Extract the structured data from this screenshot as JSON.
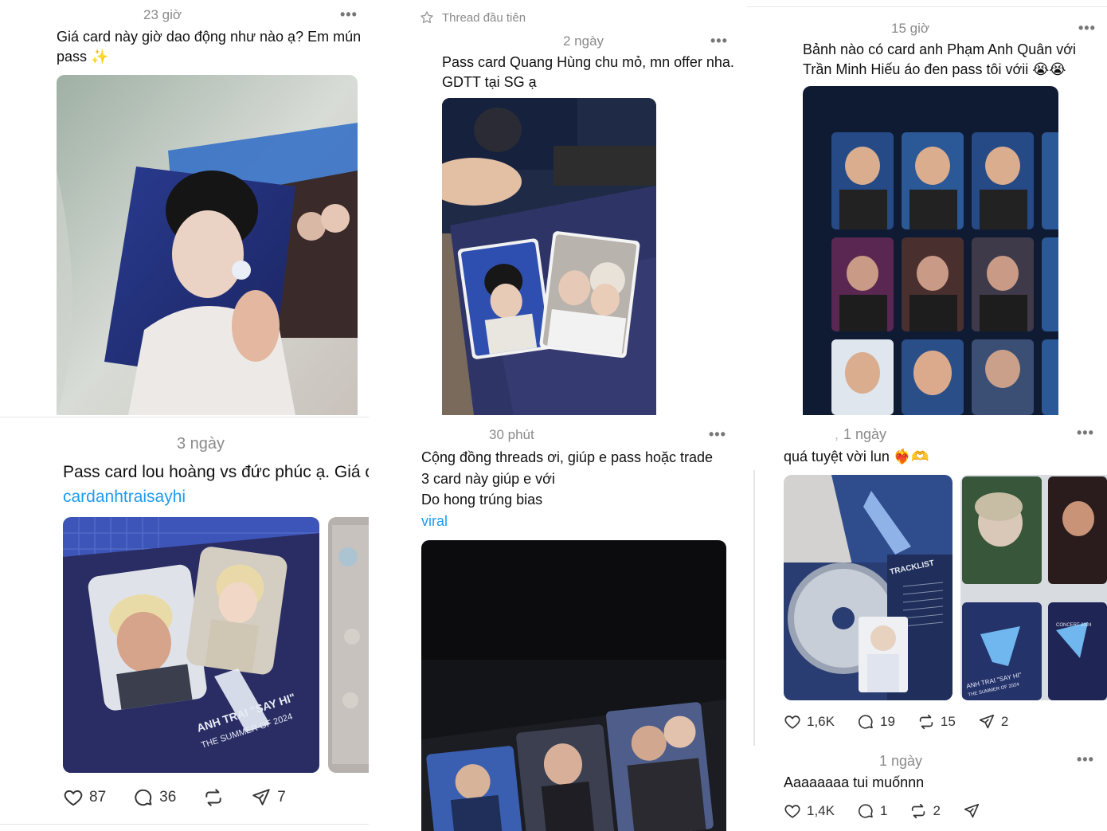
{
  "posts": [
    {
      "time": "23 giờ",
      "text_line1": "Giá card này giờ dao động như nào ạ? Em mún",
      "text_line2": "pass",
      "emoji": "✨"
    },
    {
      "badge": "Thread đầu tiên",
      "time": "2 ngày",
      "text_line1": "Pass card Quang Hùng chu mỏ, mn offer nha.",
      "text_line2": "GDTT tại SG ạ"
    },
    {
      "time": "15 giờ",
      "text_line1": "Bảnh nào có card anh Phạm Anh Quân với",
      "text_line2": "Trần Minh Hiếu áo đen pass tôi vớii",
      "emoji": "😭😭"
    },
    {
      "time": "3 ngày",
      "text_line1": "Pass card lou hoàng vs đức phúc ạ. Giá c",
      "tag": "cardanhtraisayhi",
      "image_caption_line1": "ANH TRAI \"SAY HI\"",
      "image_caption_line2": "THE SUMMER OF 2024",
      "likes": "87",
      "replies": "36",
      "shares": "7"
    },
    {
      "time": "30 phút",
      "text_line1": "Cộng đồng threads ơi, giúp e pass hoặc trade",
      "text_line2": "3 card này giúp e với",
      "text_line3": "Do hong trúng bias",
      "tag": "viral"
    },
    {
      "time": "1 ngày",
      "text_line1": "quá tuyệt vời lun",
      "emoji": "❤️‍🔥🫶",
      "image_label": "TRACKLIST",
      "image_caption_line1": "ANH TRAI \"SAY HI\"",
      "image_caption_line2": "THE SUMMER OF 2024",
      "image_caption_line3": "CONCERT 2024",
      "likes": "1,6K",
      "replies": "19",
      "reposts": "15",
      "shares": "2"
    },
    {
      "time": "1 ngày",
      "text_line1": "Aaaaaaaa tui muốnnn",
      "likes": "1,4K",
      "replies": "1",
      "reposts": "2"
    }
  ],
  "icons": {
    "more": "more-dots-icon",
    "star": "star-icon",
    "heart": "heart-icon",
    "reply": "reply-bubble-icon",
    "repost": "repost-icon",
    "share": "share-paperplane-icon"
  },
  "more_label": "•••",
  "colors": {
    "link": "#1d9bf0",
    "muted": "#8a8a8a"
  }
}
